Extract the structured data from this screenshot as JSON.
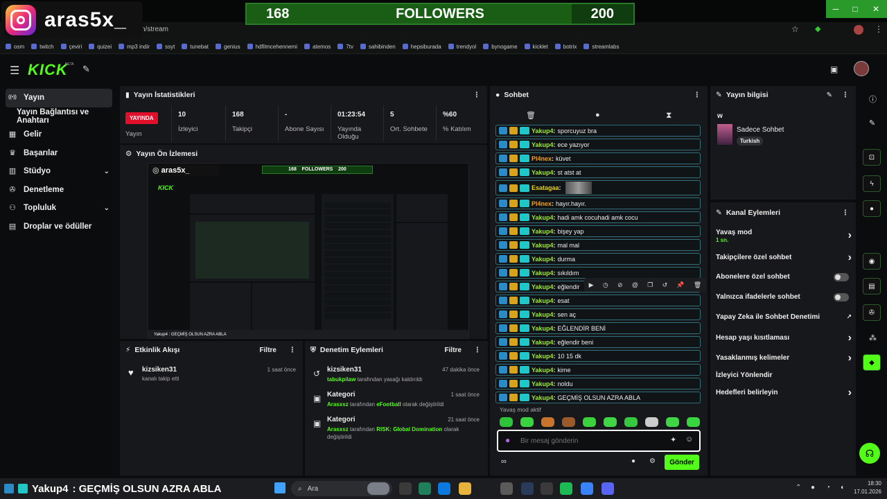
{
  "overlay": {
    "streamer_name": "aras5x_",
    "follower_goal": {
      "current": "168",
      "label": "FOLLOWERS",
      "target": "200",
      "progress": 0.84
    }
  },
  "browser": {
    "url_fragment": "n/stream",
    "bookmarks": [
      "osm",
      "twitch",
      "çeviri",
      "quizei",
      "mp3 indir",
      "ssyt",
      "tunebat",
      "genius",
      "hdfilmcehennemi",
      "atemos",
      "7tv",
      "sahibinden",
      "hepsiburada",
      "trendyol",
      "bynogame",
      "kicklet",
      "botrix",
      "streamlabs"
    ]
  },
  "header": {
    "logo": "KICK",
    "beta": "BETA"
  },
  "leftnav": {
    "items": [
      {
        "label": "Yayın",
        "icon": "broadcast-icon",
        "active": true
      },
      {
        "label": "Yayın Bağlantısı ve Anahtarı",
        "sub": true
      },
      {
        "label": "Gelir",
        "icon": "revenue-icon"
      },
      {
        "label": "Başarılar",
        "icon": "trophy-icon"
      },
      {
        "label": "Stüdyo",
        "icon": "studio-icon",
        "chevron": true
      },
      {
        "label": "Denetleme",
        "icon": "wrench-icon"
      },
      {
        "label": "Topluluk",
        "icon": "community-icon",
        "chevron": true
      },
      {
        "label": "Droplar ve ödüller",
        "icon": "gift-icon"
      }
    ]
  },
  "stats": {
    "title": "Yayın İstatistikleri",
    "live_badge": "YAYINDA",
    "live_label": "Yayın",
    "items": [
      {
        "value": "10",
        "label": "İzleyici"
      },
      {
        "value": "168",
        "label": "Takipçi"
      },
      {
        "value": "-",
        "label": "Abone Sayısı"
      },
      {
        "value": "01:23:54",
        "label": "Yayında Olduğu"
      },
      {
        "value": "5",
        "label": "Ort. Sohbete"
      },
      {
        "value": "%60",
        "label": "% Katılım"
      }
    ]
  },
  "preview": {
    "title": "Yayın Ön İzlemesi"
  },
  "activity": {
    "title": "Etkinlik Akışı",
    "filter": "Filtre",
    "items": [
      {
        "user": "kizsiken31",
        "text": "kanalı takip etti",
        "time": "1 saat önce"
      }
    ]
  },
  "moderation": {
    "title": "Denetim Eylemleri",
    "filter": "Filtre",
    "items": [
      {
        "title": "kizsiken31",
        "time": "47 dakika önce",
        "actor": "tabukpilaw",
        "text": "tarafından yasağı kaldırıldı"
      },
      {
        "title": "Kategori",
        "time": "1 saat önce",
        "actor": "Arasxsz",
        "mid": "tarafından",
        "hl": "eFootball",
        "text": "olarak değiştirildi"
      },
      {
        "title": "Kategori",
        "time": "21 saat önce",
        "actor": "Arasxsz",
        "mid": "tarafından",
        "hl": "RISK: Global Domination",
        "text": "olarak değiştirildi"
      }
    ]
  },
  "chat": {
    "title": "Sohbet",
    "messages": [
      {
        "user": "Yakup4",
        "text": "sporcuyuz bra"
      },
      {
        "user": "Yakup4",
        "text": "ece yazıyor"
      },
      {
        "user": "Pl4nex",
        "text": "küvet",
        "color": "orange"
      },
      {
        "user": "Yakup4",
        "text": "st atst at"
      },
      {
        "user": "Esatagaa",
        "text": "",
        "color": "yellow",
        "image": true
      },
      {
        "user": "Pl4nex",
        "text": "hayır.hayır.",
        "color": "orange"
      },
      {
        "user": "Yakup4",
        "text": "hadi amk cocuhadi amk cocu"
      },
      {
        "user": "Yakup4",
        "text": "bişey yap"
      },
      {
        "user": "Yakup4",
        "text": "mal mal"
      },
      {
        "user": "Yakup4",
        "text": "durma"
      },
      {
        "user": "Yakup4",
        "text": "sıkıldım"
      },
      {
        "user": "Yakup4",
        "text": "eğlendir"
      },
      {
        "user": "Yakup4",
        "text": "esat"
      },
      {
        "user": "Yakup4",
        "text": "sen aç"
      },
      {
        "user": "Yakup4",
        "text": "EĞLENDİR BENİ"
      },
      {
        "user": "Yakup4",
        "text": "eğlendir beni"
      },
      {
        "user": "Yakup4",
        "text": "10 15 dk"
      },
      {
        "user": "Yakup4",
        "text": "kime"
      },
      {
        "user": "Yakup4",
        "text": "noldu"
      },
      {
        "user": "Yakup4",
        "text": "GEÇMİŞ OLSUN AZRA ABLA"
      }
    ],
    "slow_mode": "Yavaş mod aktif",
    "input_placeholder": "Bir mesaj gönderin",
    "send_label": "Gönder"
  },
  "stream_info": {
    "title": "Yayın bilgisi",
    "stream_title": "w",
    "category": "Sadece Sohbet",
    "tag": "Turkish"
  },
  "channel_actions": {
    "title": "Kanal Eylemleri",
    "items": [
      {
        "label": "Yavaş mod",
        "sub": "1 sn.",
        "control": "arrow"
      },
      {
        "label": "Takipçilere özel sohbet",
        "control": "arrow"
      },
      {
        "label": "Abonelere özel sohbet",
        "control": "toggle"
      },
      {
        "label": "Yalnızca ifadelerle sohbet",
        "control": "toggle"
      },
      {
        "label": "Yapay Zeka ile Sohbet Denetimi",
        "control": "external"
      },
      {
        "label": "Hesap yaşı kısıtlaması",
        "control": "arrow"
      },
      {
        "label": "Yasaklanmış kelimeler",
        "control": "arrow"
      },
      {
        "label": "İzleyici Yönlendir",
        "control": "none"
      },
      {
        "label": "Hedefleri belirleyin",
        "control": "arrow"
      }
    ]
  },
  "ticker": {
    "user": "Yakup4",
    "text": ": GEÇMİŞ OLSUN AZRA ABLA"
  },
  "taskbar": {
    "search": "Ara",
    "time": "18:30",
    "date": "17.01.2026"
  },
  "colors": {
    "kick_green": "#53fc18",
    "live_red": "#e0102b",
    "bg": "#0b0c0e",
    "panel": "#17181b"
  }
}
